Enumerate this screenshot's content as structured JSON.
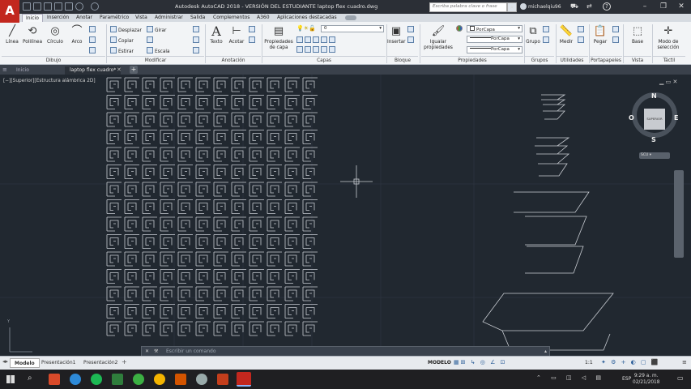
{
  "app": {
    "logo_letter": "A",
    "window_title": "Autodesk AutoCAD 2018 - VERSIÓN DEL ESTUDIANTE     laptop flex cuadro.dwg",
    "search_placeholder": "Escriba palabra clave o frase",
    "user": "michaelqiu96"
  },
  "ribbon_tabs": [
    "Inicio",
    "Inserción",
    "Anotar",
    "Paramétrico",
    "Vista",
    "Administrar",
    "Salida",
    "Complementos",
    "A360",
    "Aplicaciones destacadas"
  ],
  "ribbon": {
    "dibujo": {
      "title": "Dibujo",
      "tools": [
        "Línea",
        "Polilínea",
        "Círculo",
        "Arco"
      ]
    },
    "modificar": {
      "title": "Modificar",
      "items": [
        "Desplazar",
        "Girar",
        "Copiar",
        "Estirar",
        "Escala"
      ]
    },
    "anotacion": {
      "title": "Anotación",
      "tools": [
        "Texto",
        "Acotar"
      ]
    },
    "capas": {
      "title": "Capas",
      "tool": "Propiedades de capa",
      "layer_value": "0"
    },
    "bloque": {
      "title": "Bloque",
      "tool": "Insertar"
    },
    "propiedades": {
      "title": "Propiedades",
      "tool": "Igualar propiedades",
      "color": "PorCapa",
      "linetype": "PorCapa",
      "lineweight": "PorCapa"
    },
    "grupos": {
      "title": "Grupos",
      "tool": "Grupo"
    },
    "utilidades": {
      "title": "Utilidades",
      "tool": "Medir"
    },
    "portapapeles": {
      "title": "Portapapeles",
      "tool": "Pegar"
    },
    "vista": {
      "title": "Vista",
      "tool": "Base"
    },
    "tactil": {
      "title": "Táctil",
      "tool": "Modo de selección"
    }
  },
  "file_tabs": {
    "start": "Inicio",
    "active": "laptop flex cuadro*"
  },
  "viewport": {
    "label": "[−][Superior][Estructura alámbrica 2D]",
    "viewcube": {
      "n": "N",
      "s": "S",
      "e": "E",
      "w": "O",
      "face": "SUPERIOR"
    },
    "wcs": "SCU"
  },
  "layout_tabs": [
    "Modelo",
    "Presentación1",
    "Presentación2"
  ],
  "command_placeholder": "Escribir un comando",
  "status": {
    "mode": "MODELO",
    "scale": "1:1"
  },
  "clock": {
    "time": "9:29 a. m.",
    "date": "02/21/2018",
    "lang": "ESP"
  },
  "colors": {
    "accent": "#c2271e",
    "canvas": "#212830",
    "lines": "#c8ccd2"
  }
}
